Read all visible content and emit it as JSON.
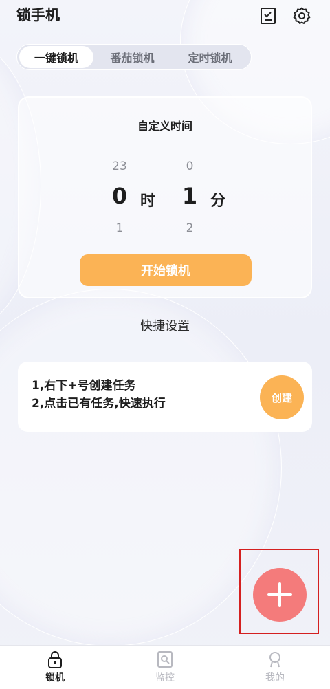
{
  "app": {
    "title": "锁手机"
  },
  "header": {
    "checklist_icon": "checklist-icon",
    "settings_icon": "gear-icon"
  },
  "tabs": [
    {
      "label": "一键锁机",
      "active": true
    },
    {
      "label": "番茄锁机",
      "active": false
    },
    {
      "label": "定时锁机",
      "active": false
    }
  ],
  "timer": {
    "title": "自定义时间",
    "hours": {
      "prev": "23",
      "current": "0",
      "next": "1",
      "unit": "时"
    },
    "minutes": {
      "prev": "0",
      "current": "1",
      "next": "2",
      "unit": "分"
    },
    "start_label": "开始锁机"
  },
  "shortcuts": {
    "title": "快捷设置",
    "hint1": "1,右下+号创建任务",
    "hint2": "2,点击已有任务,快速执行",
    "create_label": "创建"
  },
  "fab": {
    "icon": "plus-icon"
  },
  "nav": [
    {
      "label": "锁机",
      "icon": "lock-icon",
      "active": true
    },
    {
      "label": "监控",
      "icon": "monitor-icon",
      "active": false
    },
    {
      "label": "我的",
      "icon": "user-icon",
      "active": false
    }
  ],
  "colors": {
    "accent": "#fbb355",
    "fab": "#f47b7b",
    "highlight": "#d42020"
  }
}
